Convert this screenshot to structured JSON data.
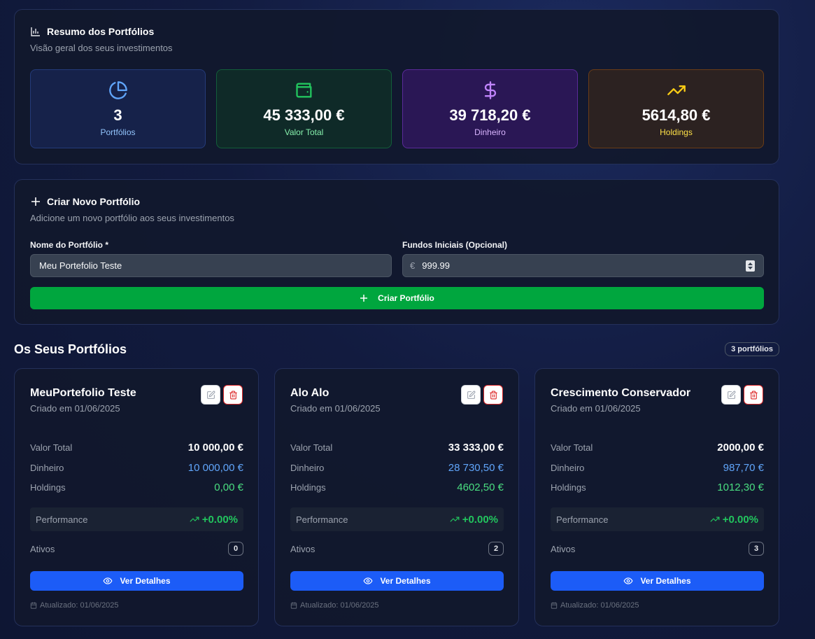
{
  "summary": {
    "title": "Resumo dos Portfólios",
    "subtitle": "Visão geral dos seus investimentos",
    "stats": [
      {
        "value": "3",
        "label": "Portfólios",
        "icon": "pie-chart-icon",
        "color": "#60a5fa"
      },
      {
        "value": "45 333,00 €",
        "label": "Valor Total",
        "icon": "wallet-icon",
        "color": "#22c55e"
      },
      {
        "value": "39 718,20 €",
        "label": "Dinheiro",
        "icon": "dollar-icon",
        "color": "#c084fc"
      },
      {
        "value": "5614,80 €",
        "label": "Holdings",
        "icon": "trending-up-icon",
        "color": "#facc15"
      }
    ]
  },
  "create": {
    "title": "Criar Novo Portfólio",
    "subtitle": "Adicione um novo portfólio aos seus investimentos",
    "name_label": "Nome do Portfólio *",
    "name_value": "Meu Portefolio Teste",
    "funds_label": "Fundos Iniciais (Opcional)",
    "currency_symbol": "€",
    "funds_value": "999.99",
    "submit_label": "Criar Portfólio"
  },
  "list": {
    "title": "Os Seus Portfólios",
    "count_badge": "3 portfólios"
  },
  "labels": {
    "total": "Valor Total",
    "cash": "Dinheiro",
    "holdings": "Holdings",
    "performance": "Performance",
    "assets": "Ativos",
    "view": "Ver Detalhes"
  },
  "portfolios": [
    {
      "name": "MeuPortefolio Teste",
      "created": "Criado em 01/06/2025",
      "total": "10 000,00 €",
      "cash": "10 000,00 €",
      "holdings": "0,00 €",
      "performance": "+0.00%",
      "assets": "0",
      "updated": "Atualizado: 01/06/2025"
    },
    {
      "name": "Alo Alo",
      "created": "Criado em 01/06/2025",
      "total": "33 333,00 €",
      "cash": "28 730,50 €",
      "holdings": "4602,50 €",
      "performance": "+0.00%",
      "assets": "2",
      "updated": "Atualizado: 01/06/2025"
    },
    {
      "name": "Crescimento Conservador",
      "created": "Criado em 01/06/2025",
      "total": "2000,00 €",
      "cash": "987,70 €",
      "holdings": "1012,30 €",
      "performance": "+0.00%",
      "assets": "3",
      "updated": "Atualizado: 01/06/2025"
    }
  ]
}
